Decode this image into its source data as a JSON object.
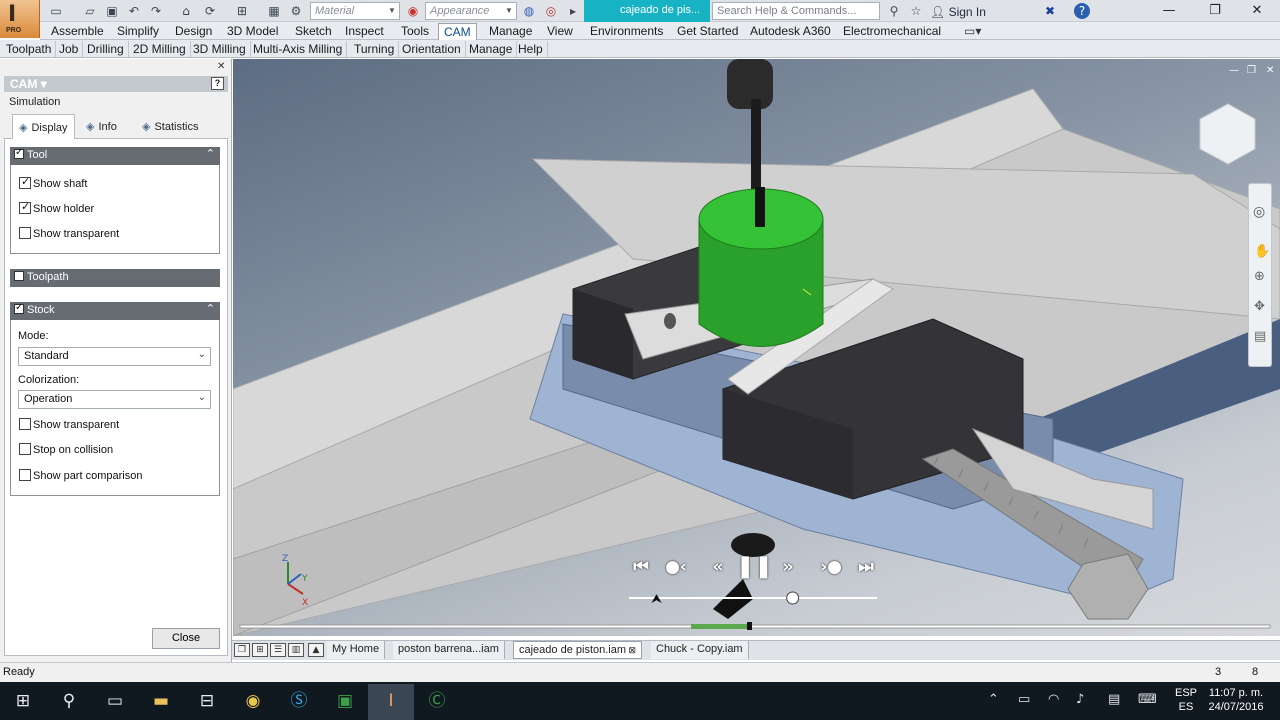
{
  "title_bar": {
    "app_logo_letter": "I",
    "app_edition": "PRO",
    "material_placeholder": "Material",
    "appearance_placeholder": "Appearance",
    "document_title": "cajeado de pis...",
    "help_search_placeholder": "Search Help & Commands...",
    "sign_in": "Sign In"
  },
  "ribbon_tabs": [
    "Assemble",
    "Simplify",
    "Design",
    "3D Model",
    "Sketch",
    "Inspect",
    "Tools",
    "CAM",
    "Manage",
    "View",
    "Environments",
    "Get Started",
    "Autodesk A360",
    "Electromechanical"
  ],
  "ribbon_active_tab": "CAM",
  "panel_items": [
    "Toolpath",
    "Job",
    "Drilling",
    "2D Milling",
    "3D Milling",
    "Multi-Axis Milling",
    "Turning",
    "Orientation",
    "Manage",
    "Help"
  ],
  "left_panel": {
    "header": "CAM ▾",
    "help_glyph": "?",
    "subtitle": "Simulation",
    "tabs": [
      {
        "label": "Display",
        "icon": "display-icon",
        "active": true
      },
      {
        "label": "Info",
        "icon": "info-icon",
        "active": false
      },
      {
        "label": "Statistics",
        "icon": "statistics-icon",
        "active": false
      }
    ],
    "tool_group": {
      "title": "Tool",
      "checked": true,
      "options": [
        {
          "label": "Show shaft",
          "checked": true
        },
        {
          "label": "Show holder",
          "checked": true
        },
        {
          "label": "Show transparent",
          "checked": false
        }
      ]
    },
    "toolpath_group": {
      "title": "Toolpath",
      "checked": false
    },
    "stock_group": {
      "title": "Stock",
      "checked": true,
      "mode_label": "Mode:",
      "mode_value": "Standard",
      "colorization_label": "Colorization:",
      "colorization_value": "Operation",
      "options": [
        {
          "label": "Show transparent",
          "checked": false
        },
        {
          "label": "Stop on collision",
          "checked": false
        },
        {
          "label": "Show part comparison",
          "checked": false
        }
      ]
    },
    "close_label": "Close"
  },
  "simulation_controls": {
    "buttons": [
      "go-to-start",
      "previous-operation",
      "step-back",
      "pause",
      "step-forward",
      "next-operation",
      "go-to-end"
    ],
    "speed_position": 0.66
  },
  "document_tabs": [
    {
      "label": "My Home",
      "active": false
    },
    {
      "label": "poston barrena...iam",
      "active": false
    },
    {
      "label": "cajeado de piston.iam",
      "active": true
    },
    {
      "label": "Chuck - Copy.iam",
      "active": false
    }
  ],
  "status_bar": {
    "text": "Ready",
    "num1": "3",
    "num2": "8"
  },
  "taskbar": {
    "lang_top": "ESP",
    "lang_bottom": "ES",
    "time": "11:07 p. m.",
    "date": "24/07/2016"
  },
  "colors": {
    "accent_cyan": "#17b3c4",
    "tool_green": "#2aa12a",
    "group_header": "#676c73"
  }
}
